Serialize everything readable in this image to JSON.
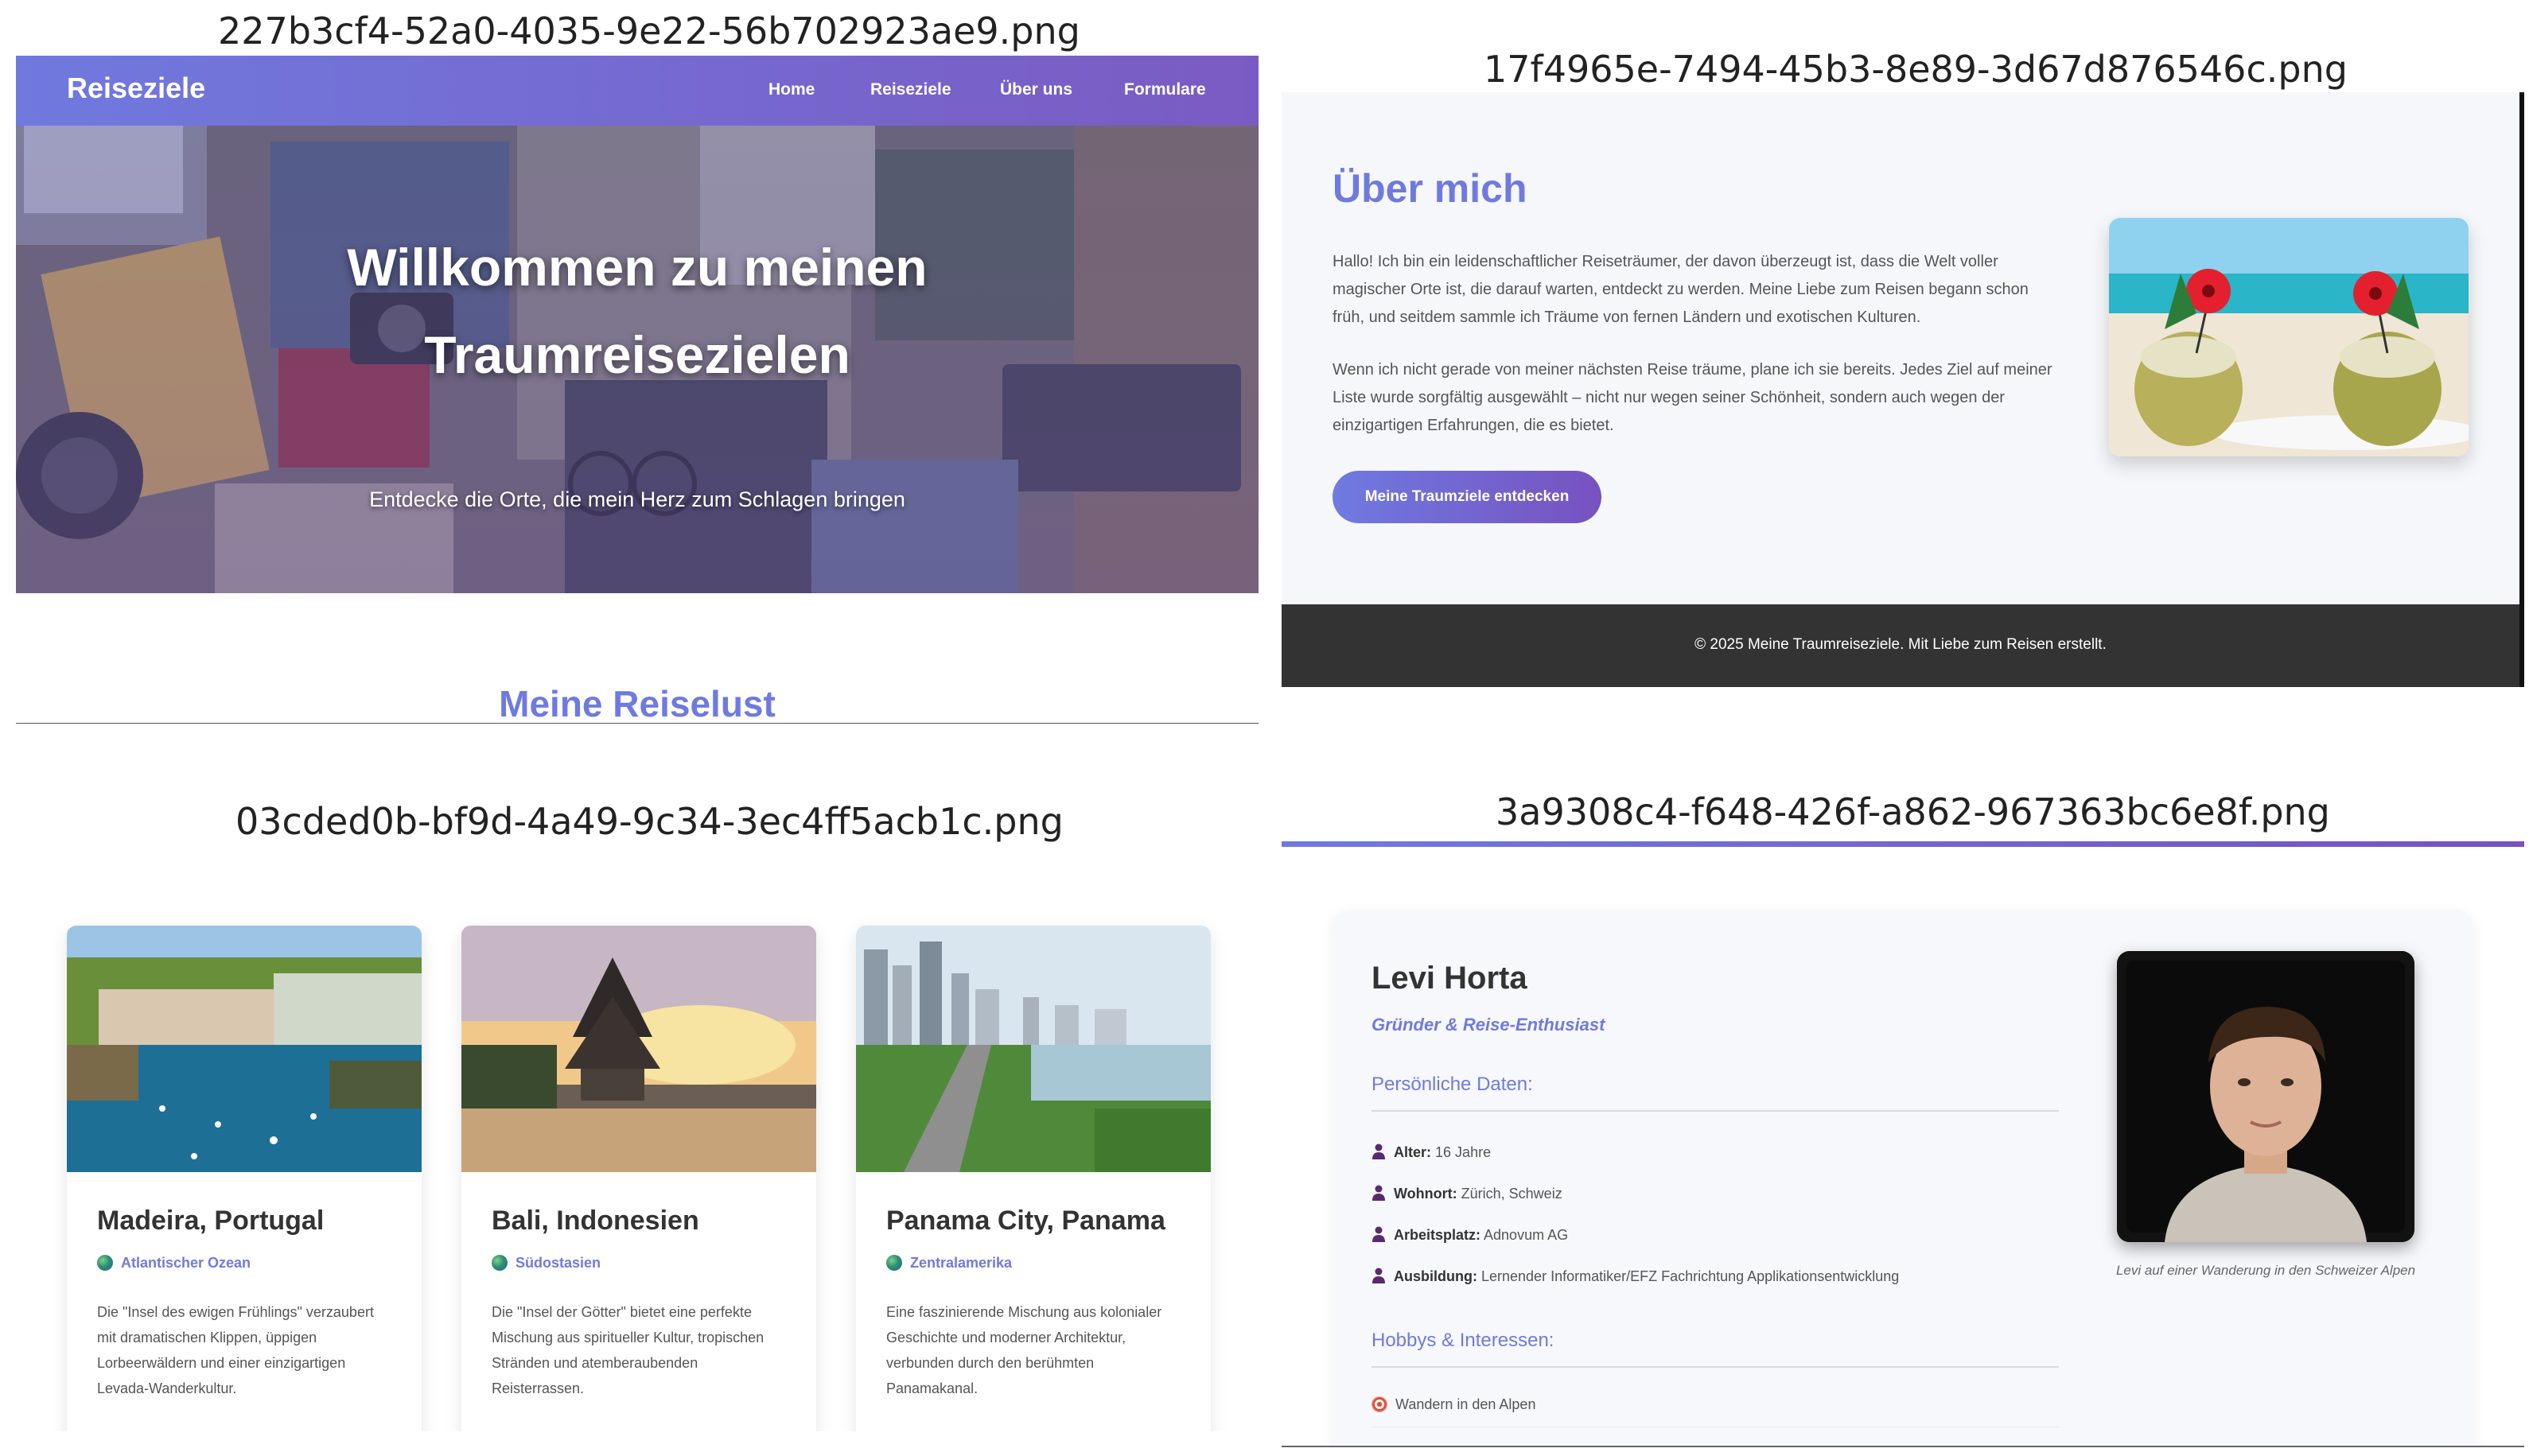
{
  "captions": {
    "p1": "227b3cf4-52a0-4035-9e22-56b702923ae9.png",
    "p2": "17f4965e-7494-45b3-8e89-3d67d876546c.png",
    "p3": "03cded0b-bf9d-4a49-9c34-3ec4ff5acb1c.png",
    "p4": "3a9308c4-f648-426f-a862-967363bc6e8f.png"
  },
  "hero_page": {
    "brand": "Reiseziele",
    "nav": [
      "Home",
      "Reiseziele",
      "Über uns",
      "Formulare"
    ],
    "hero_title_line1": "Willkommen zu meinen",
    "hero_title_line2": "Traumreisezielen",
    "hero_subtitle": "Entdecke die Orte, die mein Herz zum Schlagen bringen",
    "section_heading": "Meine Reiselust"
  },
  "about_page": {
    "title": "Über mich",
    "paragraph1": "Hallo! Ich bin ein leidenschaftlicher Reiseträumer, der davon überzeugt ist, dass die Welt voller magischer Orte ist, die darauf warten, entdeckt zu werden. Meine Liebe zum Reisen begann schon früh, und seitdem sammle ich Träume von fernen Ländern und exotischen Kulturen.",
    "paragraph2": "Wenn ich nicht gerade von meiner nächsten Reise träume, plane ich sie bereits. Jedes Ziel auf meiner Liste wurde sorgfältig ausgewählt – nicht nur wegen seiner Schönheit, sondern auch wegen der einzigartigen Erfahrungen, die es bietet.",
    "button": "Meine Traumziele entdecken",
    "footer": "© 2025 Meine Traumreiseziele. Mit Liebe zum Reisen erstellt."
  },
  "destinations": [
    {
      "title": "Madeira, Portugal",
      "region": "Atlantischer Ozean",
      "description": "Die \"Insel des ewigen Frühlings\" verzaubert mit dramatischen Klippen, üppigen Lorbeerwäldern und einer einzigartigen Levada-Wanderkultur."
    },
    {
      "title": "Bali, Indonesien",
      "region": "Südostasien",
      "description": "Die \"Insel der Götter\" bietet eine perfekte Mischung aus spiritueller Kultur, tropischen Stränden und atemberaubenden Reisterrassen."
    },
    {
      "title": "Panama City, Panama",
      "region": "Zentralamerika",
      "description": "Eine faszinierende Mischung aus kolonialer Geschichte und moderner Architektur, verbunden durch den berühmten Panamakanal."
    }
  ],
  "team_page": {
    "name": "Levi Horta",
    "role": "Gründer & Reise-Enthusiast",
    "personal_heading": "Persönliche Daten:",
    "personal": [
      {
        "label": "Alter:",
        "value": "16 Jahre"
      },
      {
        "label": "Wohnort:",
        "value": "Zürich, Schweiz"
      },
      {
        "label": "Arbeitsplatz:",
        "value": "Adnovum AG"
      },
      {
        "label": "Ausbildung:",
        "value": "Lernender Informatiker/EFZ Fachrichtung Applikationsentwicklung"
      }
    ],
    "hobbies_heading": "Hobbys & Interessen:",
    "hobbies": [
      "Wandern in den Alpen"
    ],
    "photo_caption": "Levi auf einer Wanderung in den Schweizer Alpen"
  },
  "colors": {
    "accent": "#6f7ae0",
    "accent_end": "#7752c0",
    "footer_bg": "#333333"
  }
}
